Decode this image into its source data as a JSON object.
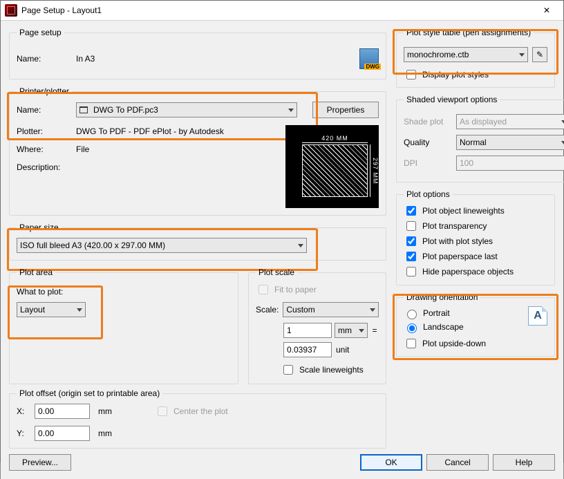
{
  "title": "Page Setup - Layout1",
  "pageSetup": {
    "legend": "Page setup",
    "nameLabel": "Name:",
    "name": "In A3"
  },
  "printer": {
    "legend": "Printer/plotter",
    "nameLabel": "Name:",
    "name": "DWG To PDF.pc3",
    "propertiesBtn": "Properties",
    "plotterLabel": "Plotter:",
    "plotter": "DWG To PDF - PDF ePlot - by Autodesk",
    "whereLabel": "Where:",
    "where": "File",
    "descLabel": "Description:",
    "previewW": "420 MM",
    "previewH": "297 MM"
  },
  "paper": {
    "legend": "Paper size",
    "size": "ISO full bleed A3 (420.00 x 297.00 MM)"
  },
  "plotArea": {
    "legend": "Plot area",
    "whatLabel": "What to plot:",
    "what": "Layout"
  },
  "plotScale": {
    "legend": "Plot scale",
    "fitLabel": "Fit to paper",
    "scaleLabel": "Scale:",
    "scale": "Custom",
    "num": "1",
    "numUnit": "mm",
    "equals": "=",
    "den": "0.03937",
    "denUnit": "unit",
    "scaleLW": "Scale lineweights"
  },
  "plotOffset": {
    "legend": "Plot offset (origin set to printable area)",
    "xLabel": "X:",
    "x": "0.00",
    "yLabel": "Y:",
    "y": "0.00",
    "unit": "mm",
    "centerLabel": "Center the plot"
  },
  "plotStyle": {
    "legend": "Plot style table (pen assignments)",
    "value": "monochrome.ctb",
    "displayLabel": "Display plot styles"
  },
  "shaded": {
    "legend": "Shaded viewport options",
    "shadeLabel": "Shade plot",
    "shade": "As displayed",
    "qualityLabel": "Quality",
    "quality": "Normal",
    "dpiLabel": "DPI",
    "dpi": "100"
  },
  "plotOptions": {
    "legend": "Plot options",
    "o1": "Plot object lineweights",
    "o2": "Plot transparency",
    "o3": "Plot with plot styles",
    "o4": "Plot paperspace last",
    "o5": "Hide paperspace objects"
  },
  "orientation": {
    "legend": "Drawing orientation",
    "portrait": "Portrait",
    "landscape": "Landscape",
    "upside": "Plot upside-down"
  },
  "footer": {
    "preview": "Preview...",
    "ok": "OK",
    "cancel": "Cancel",
    "help": "Help"
  }
}
